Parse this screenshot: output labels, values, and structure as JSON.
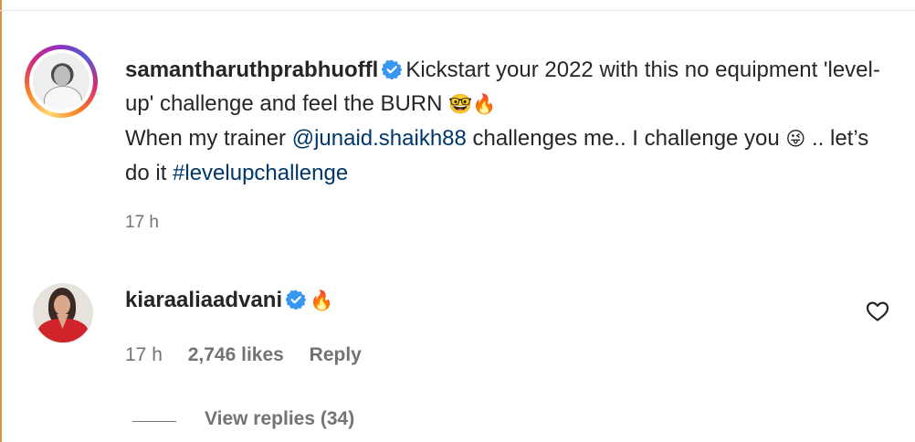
{
  "post": {
    "username": "samantharuthprabhuoffl",
    "caption_part1": "Kickstart your 2022 with this no equipment 'level- up' challenge and feel the BURN ",
    "emoji_nerd": "🤓",
    "emoji_fire": "🔥",
    "caption_part2": "When my trainer ",
    "mention": "@junaid.shaikh88",
    "caption_part3": " challenges me.. I challenge you ",
    "emoji_wink": "😜",
    "caption_part4": " .. let’s do it ",
    "hashtag": "#levelupchallenge",
    "time": "17 h"
  },
  "comment": {
    "username": "kiaraaliaadvani",
    "emoji": "🔥",
    "time": "17 h",
    "likes": "2,746 likes",
    "reply_label": "Reply",
    "view_replies": "View replies (34)"
  },
  "icons": {
    "verified": "verified-badge-icon",
    "like": "heart-outline-icon"
  },
  "colors": {
    "text": "#262626",
    "secondary": "#737373",
    "link": "#00376b",
    "verified": "#3897f0"
  }
}
